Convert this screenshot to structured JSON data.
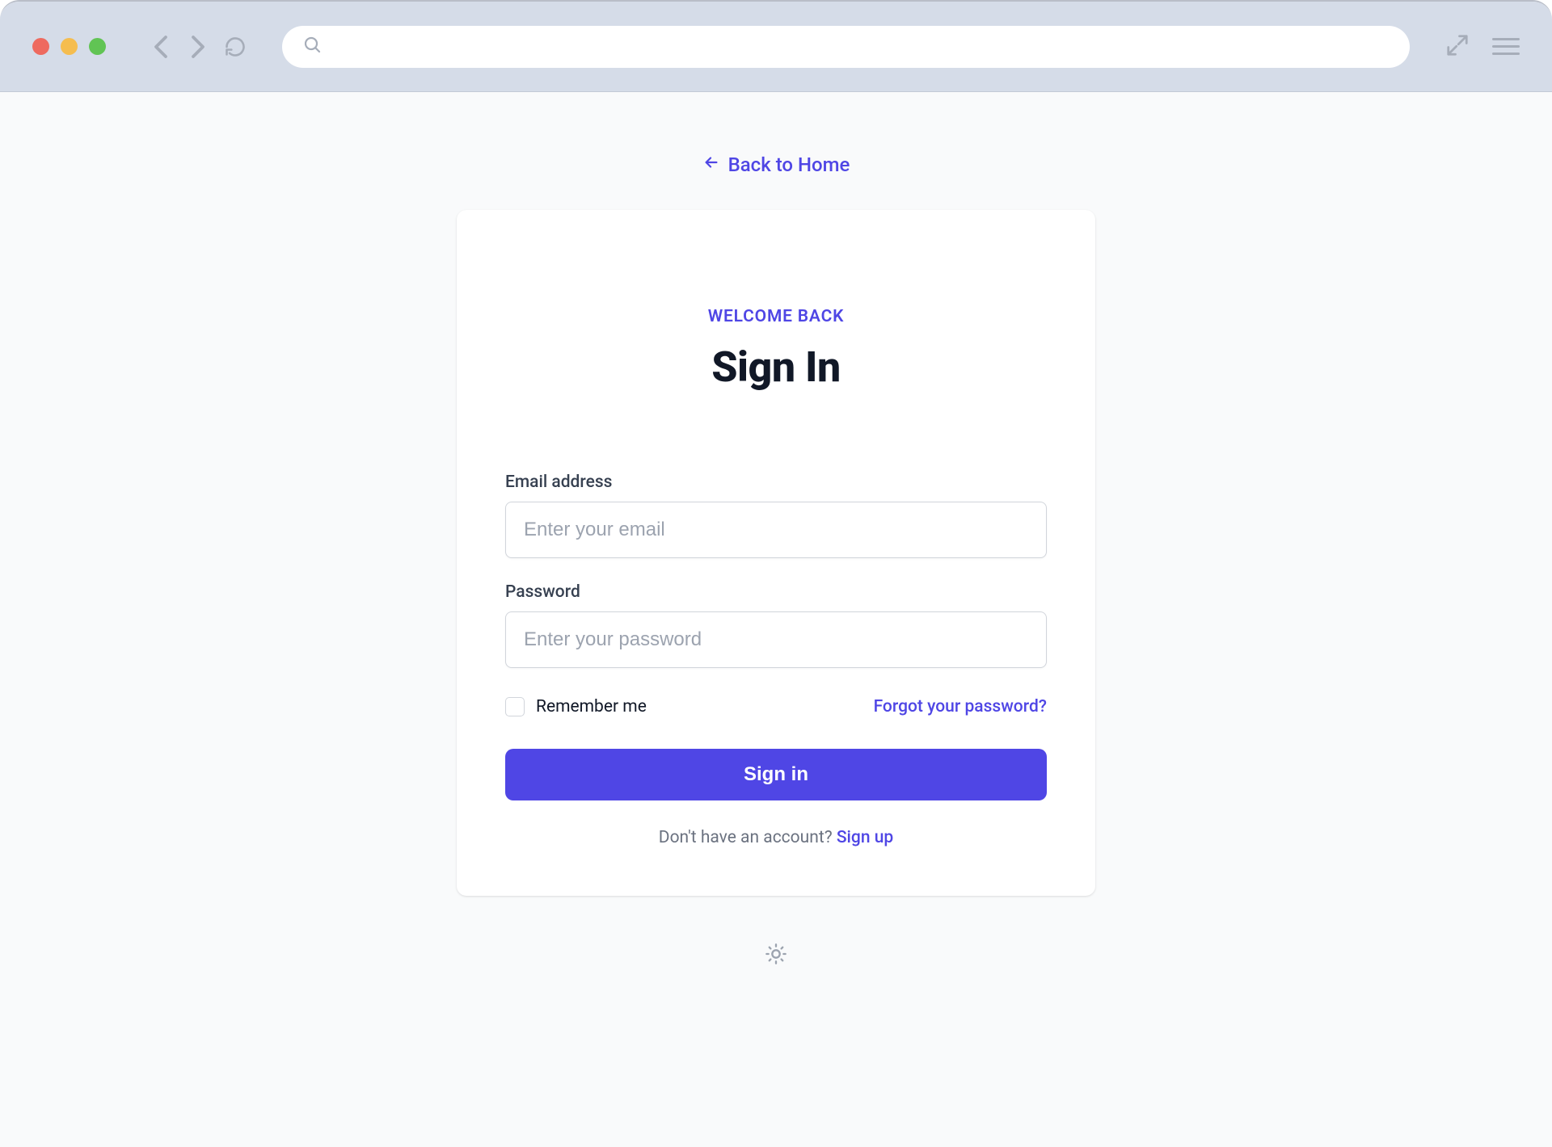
{
  "nav": {
    "back_label": "Back to Home"
  },
  "card": {
    "eyebrow": "WELCOME BACK",
    "heading": "Sign In"
  },
  "form": {
    "email_label": "Email address",
    "email_placeholder": "Enter your email",
    "password_label": "Password",
    "password_placeholder": "Enter your password",
    "remember_label": "Remember me",
    "forgot_label": "Forgot your password?",
    "submit_label": "Sign in"
  },
  "footer": {
    "prompt": "Don't have an account? ",
    "signup_label": "Sign up"
  }
}
